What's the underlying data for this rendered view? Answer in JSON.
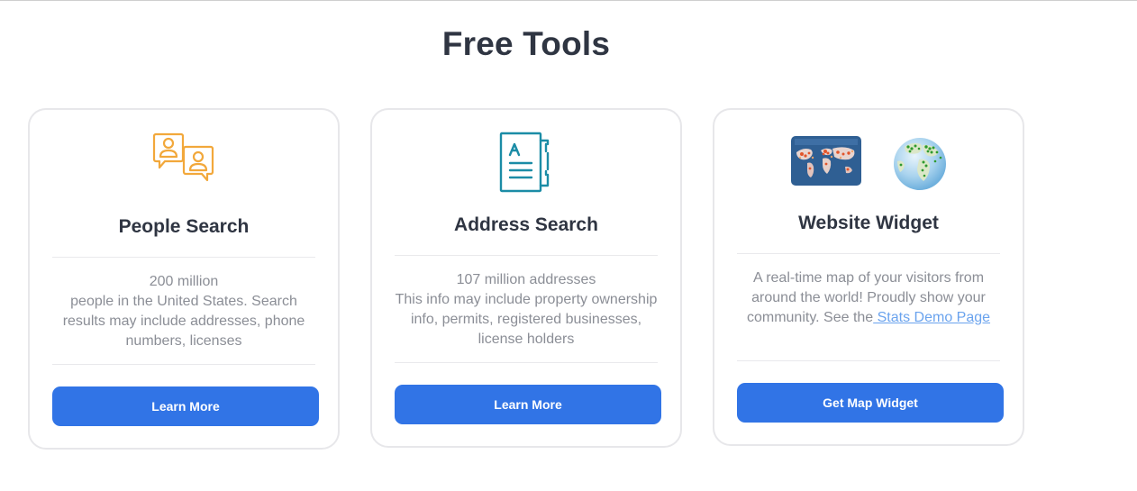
{
  "section": {
    "title": "Free Tools"
  },
  "cards": [
    {
      "icon": "people-chat-icon",
      "title": "People Search",
      "desc_lines": [
        "200 million",
        "people in the United States. Search",
        "results may include addresses, phone",
        "numbers, licenses"
      ],
      "button": "Learn More"
    },
    {
      "icon": "address-document-icon",
      "title": "Address Search",
      "desc_lines": [
        "107 million addresses",
        "This info may include property ownership",
        "info, permits, registered businesses,",
        "license holders"
      ],
      "button": "Learn More"
    },
    {
      "icons": [
        "world-map-thumbnail-icon",
        "globe-thumbnail-icon"
      ],
      "title": "Website Widget",
      "desc_lines": [
        "A real-time map of your visitors from",
        "around the world! Proudly show your",
        "community. See the"
      ],
      "link": " Stats Demo Page",
      "button": "Get Map Widget"
    }
  ],
  "colors": {
    "accent": "#3174e6",
    "people_icon": "#f2a83b",
    "address_icon": "#1b8ca6",
    "link": "#6aa3ee",
    "title": "#2f3542",
    "body_text": "#8b8e96"
  }
}
